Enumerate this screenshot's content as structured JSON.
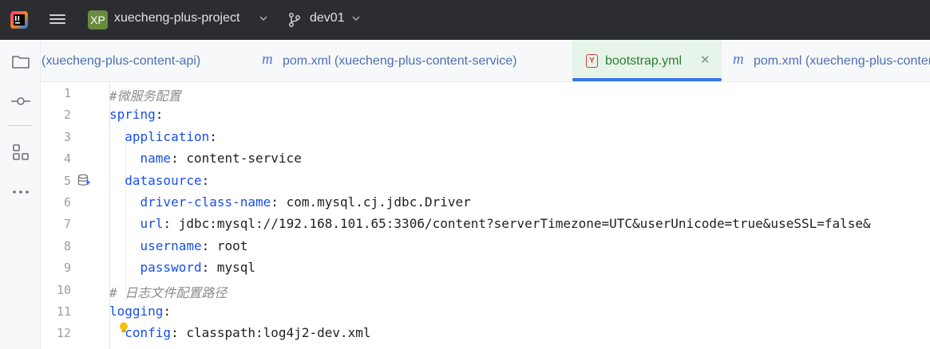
{
  "titlebar": {
    "project_badge": "XP",
    "project_name": "xuecheng-plus-project",
    "branch": "dev01"
  },
  "tabs": [
    {
      "label": "(xuecheng-plus-content-api)",
      "icon": "",
      "active": false
    },
    {
      "label": "pom.xml (xuecheng-plus-content-service)",
      "icon": "m",
      "active": false
    },
    {
      "label": "bootstrap.yml",
      "icon": "Y",
      "active": true
    },
    {
      "label": "pom.xml (xuecheng-plus-content-service)",
      "icon": "m",
      "active": false
    }
  ],
  "editor": {
    "lines": [
      {
        "num": "1",
        "indent": "",
        "key": "",
        "sep": "",
        "value": "",
        "comment": "#微服务配置"
      },
      {
        "num": "2",
        "indent": "",
        "key": "spring",
        "sep": ":",
        "value": "",
        "comment": ""
      },
      {
        "num": "3",
        "indent": "  ",
        "key": "application",
        "sep": ":",
        "value": "",
        "comment": ""
      },
      {
        "num": "4",
        "indent": "    ",
        "key": "name",
        "sep": ": ",
        "value": "content-service",
        "comment": ""
      },
      {
        "num": "5",
        "indent": "  ",
        "key": "datasource",
        "sep": ":",
        "value": "",
        "comment": ""
      },
      {
        "num": "6",
        "indent": "    ",
        "key": "driver-class-name",
        "sep": ": ",
        "value": "com.mysql.cj.jdbc.Driver",
        "comment": ""
      },
      {
        "num": "7",
        "indent": "    ",
        "key": "url",
        "sep": ": ",
        "value": "jdbc:mysql://192.168.101.65:3306/content?serverTimezone=UTC&userUnicode=true&useSSL=false&",
        "comment": ""
      },
      {
        "num": "8",
        "indent": "    ",
        "key": "username",
        "sep": ": ",
        "value": "root",
        "comment": ""
      },
      {
        "num": "9",
        "indent": "    ",
        "key": "password",
        "sep": ": ",
        "value": "mysql",
        "comment": ""
      },
      {
        "num": "10",
        "indent": "",
        "key": "",
        "sep": "",
        "value": "",
        "comment": "# 日志文件配置路径"
      },
      {
        "num": "11",
        "indent": "",
        "key": "logging",
        "sep": ":",
        "value": "",
        "comment": ""
      },
      {
        "num": "12",
        "indent": "  ",
        "key": "config",
        "sep": ": ",
        "value": "classpath:log4j2-dev.xml",
        "comment": ""
      }
    ]
  },
  "colors": {
    "key": "#1750eb",
    "comment": "#8c8c8c",
    "active_tab_bg": "#e6f4ea",
    "active_tab_text": "#2e7d32",
    "tab_underline": "#3574f0"
  }
}
